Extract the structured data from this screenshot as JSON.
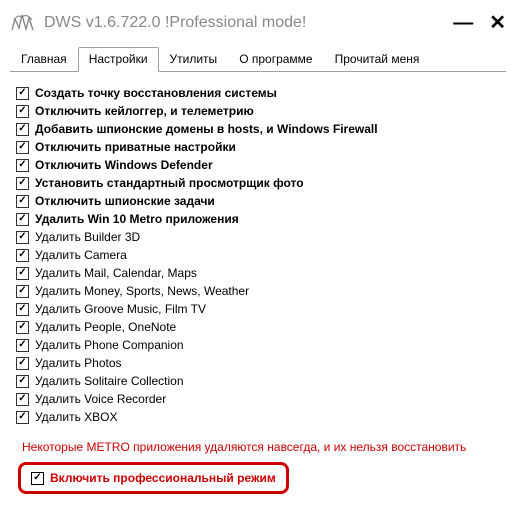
{
  "titlebar": {
    "title": "DWS v1.6.722.0  !Professional mode!"
  },
  "tabs": {
    "items": [
      {
        "label": "Главная"
      },
      {
        "label": "Настройки"
      },
      {
        "label": "Утилиты"
      },
      {
        "label": "О программе"
      },
      {
        "label": "Прочитай меня"
      }
    ],
    "active_index": 1
  },
  "checklist": [
    {
      "label": "Создать точку восстановления системы",
      "bold": true,
      "checked": true
    },
    {
      "label": "Отключить кейлоггер, и телеметрию",
      "bold": true,
      "checked": true
    },
    {
      "label": "Добавить шпионские домены в hosts, и Windows Firewall",
      "bold": true,
      "checked": true
    },
    {
      "label": "Отключить приватные настройки",
      "bold": true,
      "checked": true
    },
    {
      "label": "Отключить Windows Defender",
      "bold": true,
      "checked": true
    },
    {
      "label": "Установить стандартный просмотрщик фото",
      "bold": true,
      "checked": true
    },
    {
      "label": "Отключить шпионские задачи",
      "bold": true,
      "checked": true
    },
    {
      "label": "Удалить Win 10 Metro приложения",
      "bold": true,
      "checked": true
    },
    {
      "label": "Удалить Builder 3D",
      "bold": false,
      "checked": true
    },
    {
      "label": "Удалить Camera",
      "bold": false,
      "checked": true
    },
    {
      "label": "Удалить Mail, Calendar, Maps",
      "bold": false,
      "checked": true
    },
    {
      "label": "Удалить Money, Sports, News, Weather",
      "bold": false,
      "checked": true
    },
    {
      "label": "Удалить Groove Music, Film TV",
      "bold": false,
      "checked": true
    },
    {
      "label": "Удалить People, OneNote",
      "bold": false,
      "checked": true
    },
    {
      "label": "Удалить Phone Companion",
      "bold": false,
      "checked": true
    },
    {
      "label": "Удалить Photos",
      "bold": false,
      "checked": true
    },
    {
      "label": "Удалить Solitaire Collection",
      "bold": false,
      "checked": true
    },
    {
      "label": "Удалить Voice Recorder",
      "bold": false,
      "checked": true
    },
    {
      "label": "Удалить XBOX",
      "bold": false,
      "checked": true
    }
  ],
  "warning": "Некоторые METRO приложения удаляются навсегда, и их нельзя восстановить",
  "pro_mode": {
    "label": "Включить профессиональный режим",
    "checked": true
  }
}
